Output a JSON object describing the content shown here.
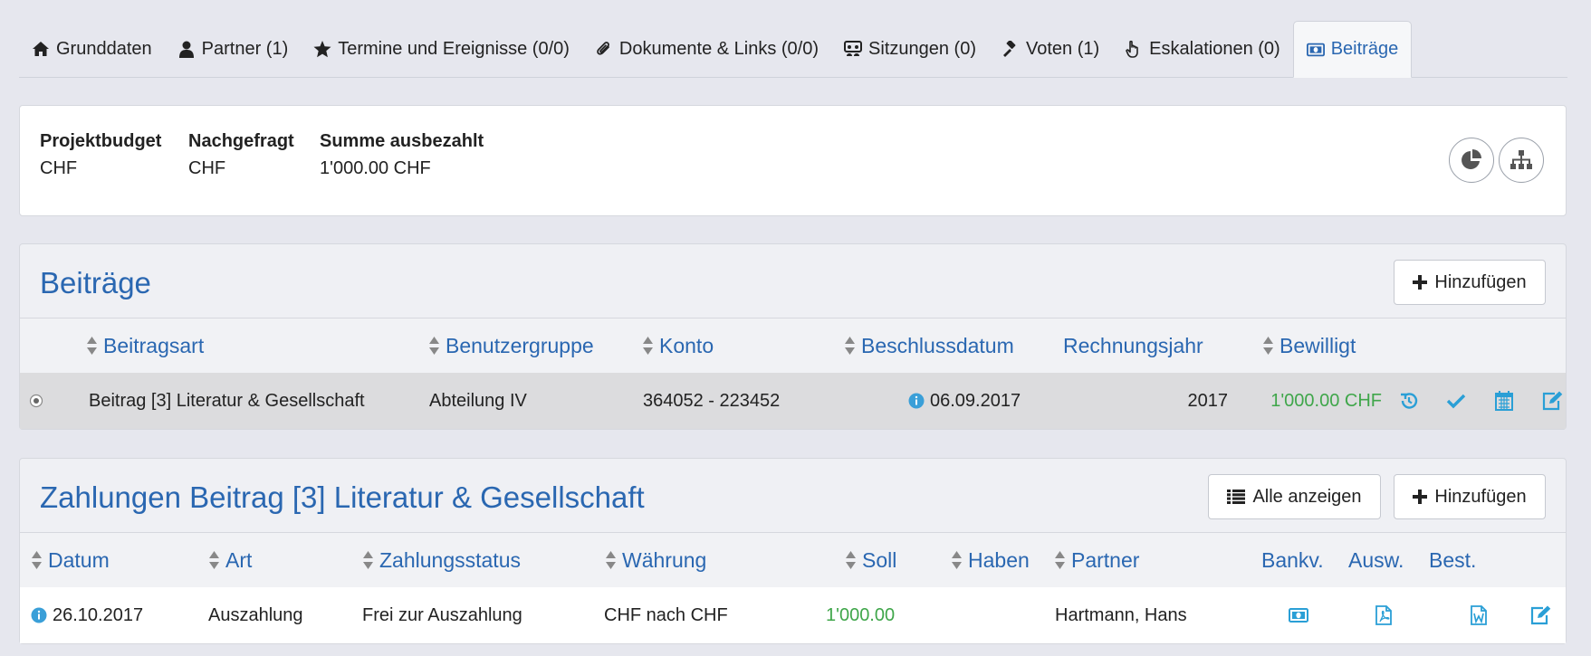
{
  "tabs": [
    {
      "label": "Grunddaten",
      "icon": "home-icon"
    },
    {
      "label": "Partner (1)",
      "icon": "user-icon"
    },
    {
      "label": "Termine und Ereignisse (0/0)",
      "icon": "star-icon"
    },
    {
      "label": "Dokumente & Links (0/0)",
      "icon": "paperclip-icon"
    },
    {
      "label": "Sitzungen (0)",
      "icon": "meeting-icon"
    },
    {
      "label": "Voten (1)",
      "icon": "gavel-icon"
    },
    {
      "label": "Eskalationen (0)",
      "icon": "hand-pointer-icon"
    },
    {
      "label": "Beiträge",
      "icon": "money-icon"
    }
  ],
  "active_tab": "Beiträge",
  "summary": {
    "projektbudget_label": "Projektbudget",
    "projektbudget_value": "CHF",
    "nachgefragt_label": "Nachgefragt",
    "nachgefragt_value": "CHF",
    "ausbezahlt_label": "Summe ausbezahlt",
    "ausbezahlt_value": "1'000.00 CHF"
  },
  "beitraege": {
    "title": "Beiträge",
    "add_label": "Hinzufügen",
    "columns": {
      "beitragsart": "Beitragsart",
      "benutzergruppe": "Benutzergruppe",
      "konto": "Konto",
      "beschlussdatum": "Beschlussdatum",
      "rechnungsjahr": "Rechnungsjahr",
      "bewilligt": "Bewilligt"
    },
    "rows": [
      {
        "beitragsart": "Beitrag [3] Literatur & Gesellschaft",
        "benutzergruppe": "Abteilung IV",
        "konto": "364052 - 223452",
        "beschlussdatum": "06.09.2017",
        "rechnungsjahr": "2017",
        "bewilligt": "1'000.00 CHF"
      }
    ]
  },
  "zahlungen": {
    "title": "Zahlungen Beitrag [3] Literatur & Gesellschaft",
    "show_all_label": "Alle anzeigen",
    "add_label": "Hinzufügen",
    "columns": {
      "datum": "Datum",
      "art": "Art",
      "zahlungsstatus": "Zahlungsstatus",
      "waehrung": "Währung",
      "soll": "Soll",
      "haben": "Haben",
      "partner": "Partner",
      "bankv": "Bankv.",
      "ausw": "Ausw.",
      "best": "Best."
    },
    "rows": [
      {
        "datum": "26.10.2017",
        "art": "Auszahlung",
        "zahlungsstatus": "Frei zur Auszahlung",
        "waehrung": "CHF nach CHF",
        "soll": "1'000.00",
        "haben": "",
        "partner": "Hartmann, Hans"
      }
    ]
  },
  "colors": {
    "accent": "#2a67b1",
    "link_icon": "#2a9fd6",
    "positive": "#3fa64a",
    "background": "#e6e7ee"
  }
}
